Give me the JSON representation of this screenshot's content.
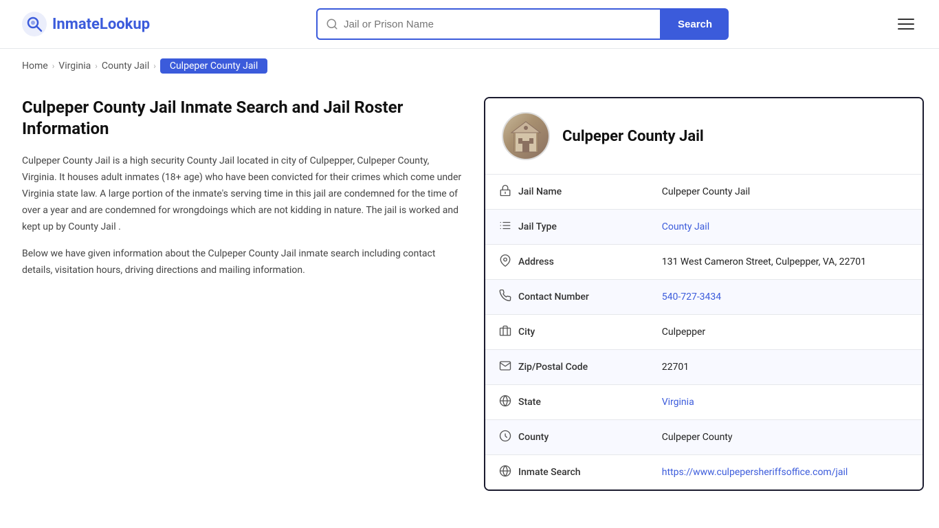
{
  "header": {
    "logo_text_part1": "Inmate",
    "logo_text_part2": "Lookup",
    "search_placeholder": "Jail or Prison Name",
    "search_button_label": "Search"
  },
  "breadcrumb": {
    "home": "Home",
    "state": "Virginia",
    "type": "County Jail",
    "current": "Culpeper County Jail"
  },
  "left": {
    "heading": "Culpeper County Jail Inmate Search and Jail Roster Information",
    "paragraph1": "Culpeper County Jail is a high security County Jail located in city of Culpepper, Culpeper County, Virginia. It houses adult inmates (18+ age) who have been convicted for their crimes which come under Virginia state law. A large portion of the inmate's serving time in this jail are condemned for the time of over a year and are condemned for wrongdoings which are not kidding in nature. The jail is worked and kept up by County Jail .",
    "paragraph2": "Below we have given information about the Culpeper County Jail inmate search including contact details, visitation hours, driving directions and mailing information."
  },
  "card": {
    "title": "Culpeper County Jail",
    "rows": [
      {
        "label": "Jail Name",
        "value": "Culpeper County Jail",
        "link": false,
        "icon": "jail-icon"
      },
      {
        "label": "Jail Type",
        "value": "County Jail",
        "link": true,
        "icon": "list-icon"
      },
      {
        "label": "Address",
        "value": "131 West Cameron Street, Culpepper, VA, 22701",
        "link": false,
        "icon": "location-icon"
      },
      {
        "label": "Contact Number",
        "value": "540-727-3434",
        "link": true,
        "icon": "phone-icon"
      },
      {
        "label": "City",
        "value": "Culpepper",
        "link": false,
        "icon": "city-icon"
      },
      {
        "label": "Zip/Postal Code",
        "value": "22701",
        "link": false,
        "icon": "mail-icon"
      },
      {
        "label": "State",
        "value": "Virginia",
        "link": true,
        "icon": "globe-icon"
      },
      {
        "label": "County",
        "value": "Culpeper County",
        "link": false,
        "icon": "county-icon"
      },
      {
        "label": "Inmate Search",
        "value": "https://www.culpepersheriffsoffice.com/jail",
        "link": true,
        "icon": "search-globe-icon"
      }
    ]
  }
}
